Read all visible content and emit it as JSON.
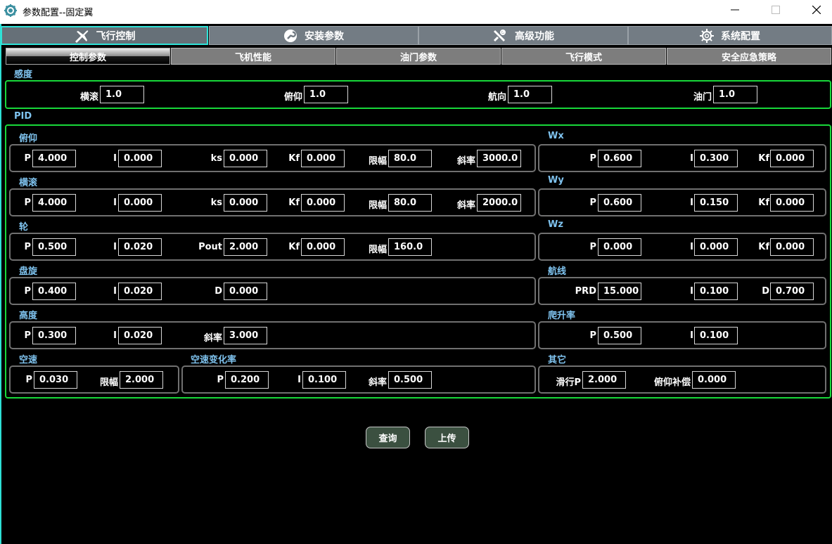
{
  "window": {
    "title": "参数配置--固定翼",
    "min_icon": "minimize-icon",
    "max_icon": "maximize-icon",
    "close_icon": "close-icon"
  },
  "top_tabs": [
    {
      "label": "飞行控制",
      "icon": "airplane-icon",
      "active": true
    },
    {
      "label": "安装参数",
      "icon": "wrench-icon",
      "active": false
    },
    {
      "label": "高级功能",
      "icon": "tools-icon",
      "active": false
    },
    {
      "label": "系统配置",
      "icon": "gear-icon",
      "active": false
    }
  ],
  "sub_tabs": [
    {
      "label": "控制参数",
      "active": true
    },
    {
      "label": "飞机性能",
      "active": false
    },
    {
      "label": "油门参数",
      "active": false
    },
    {
      "label": "飞行模式",
      "active": false
    },
    {
      "label": "安全应急策略",
      "active": false
    }
  ],
  "sensitivity": {
    "title": "感度",
    "roll": {
      "label": "横滚",
      "value": "1.0"
    },
    "pitch": {
      "label": "俯仰",
      "value": "1.0"
    },
    "yaw": {
      "label": "航向",
      "value": "1.0"
    },
    "throttle": {
      "label": "油门",
      "value": "1.0"
    }
  },
  "pid": {
    "title": "PID",
    "pitch": {
      "title": "俯仰",
      "p": {
        "label": "P",
        "value": "4.000"
      },
      "i": {
        "label": "I",
        "value": "0.000"
      },
      "ks": {
        "label": "ks",
        "value": "0.000"
      },
      "kf": {
        "label": "Kf",
        "value": "0.000"
      },
      "limit": {
        "label": "限幅",
        "value": "80.0"
      },
      "slope": {
        "label": "斜率",
        "value": "3000.0"
      }
    },
    "roll": {
      "title": "横滚",
      "p": {
        "label": "P",
        "value": "4.000"
      },
      "i": {
        "label": "I",
        "value": "0.000"
      },
      "ks": {
        "label": "ks",
        "value": "0.000"
      },
      "kf": {
        "label": "Kf",
        "value": "0.000"
      },
      "limit": {
        "label": "限幅",
        "value": "80.0"
      },
      "slope": {
        "label": "斜率",
        "value": "2000.0"
      }
    },
    "wheel": {
      "title": "轮",
      "p": {
        "label": "P",
        "value": "0.500"
      },
      "i": {
        "label": "I",
        "value": "0.020"
      },
      "pout": {
        "label": "Pout",
        "value": "2.000"
      },
      "kf": {
        "label": "Kf",
        "value": "0.000"
      },
      "limit": {
        "label": "限幅",
        "value": "160.0"
      }
    },
    "circle": {
      "title": "盘旋",
      "p": {
        "label": "P",
        "value": "0.400"
      },
      "i": {
        "label": "I",
        "value": "0.020"
      },
      "d": {
        "label": "D",
        "value": "0.000"
      }
    },
    "altitude": {
      "title": "高度",
      "p": {
        "label": "P",
        "value": "0.300"
      },
      "i": {
        "label": "I",
        "value": "0.020"
      },
      "slope": {
        "label": "斜率",
        "value": "3.000"
      }
    },
    "airspeed": {
      "title": "空速",
      "p": {
        "label": "P",
        "value": "0.030"
      },
      "limit": {
        "label": "限幅",
        "value": "2.000"
      }
    },
    "airspeed_rate": {
      "title": "空速变化率",
      "p": {
        "label": "P",
        "value": "0.200"
      },
      "i": {
        "label": "I",
        "value": "0.100"
      },
      "slope": {
        "label": "斜率",
        "value": "0.500"
      }
    },
    "wx": {
      "title": "Wx",
      "p": {
        "label": "P",
        "value": "0.600"
      },
      "i": {
        "label": "I",
        "value": "0.300"
      },
      "kf": {
        "label": "Kf",
        "value": "0.000"
      }
    },
    "wy": {
      "title": "Wy",
      "p": {
        "label": "P",
        "value": "0.600"
      },
      "i": {
        "label": "I",
        "value": "0.150"
      },
      "kf": {
        "label": "Kf",
        "value": "0.000"
      }
    },
    "wz": {
      "title": "Wz",
      "p": {
        "label": "P",
        "value": "0.000"
      },
      "i": {
        "label": "I",
        "value": "0.000"
      },
      "kf": {
        "label": "Kf",
        "value": "0.000"
      }
    },
    "route": {
      "title": "航线",
      "prd": {
        "label": "PRD",
        "value": "15.000"
      },
      "i": {
        "label": "I",
        "value": "0.100"
      },
      "d": {
        "label": "D",
        "value": "0.700"
      }
    },
    "climb": {
      "title": "爬升率",
      "p": {
        "label": "P",
        "value": "0.500"
      },
      "i": {
        "label": "I",
        "value": "0.100"
      }
    },
    "other": {
      "title": "其它",
      "taxi_p": {
        "label": "滑行P",
        "value": "2.000"
      },
      "pitch_comp": {
        "label": "俯仰补偿",
        "value": "0.000"
      }
    }
  },
  "actions": {
    "query": "查询",
    "upload": "上传"
  },
  "colors": {
    "tab_active_border": "#2fe3d8",
    "group_border": "#18d83a",
    "section_title": "#7fc3ef",
    "button_bg": "#3b5040"
  }
}
